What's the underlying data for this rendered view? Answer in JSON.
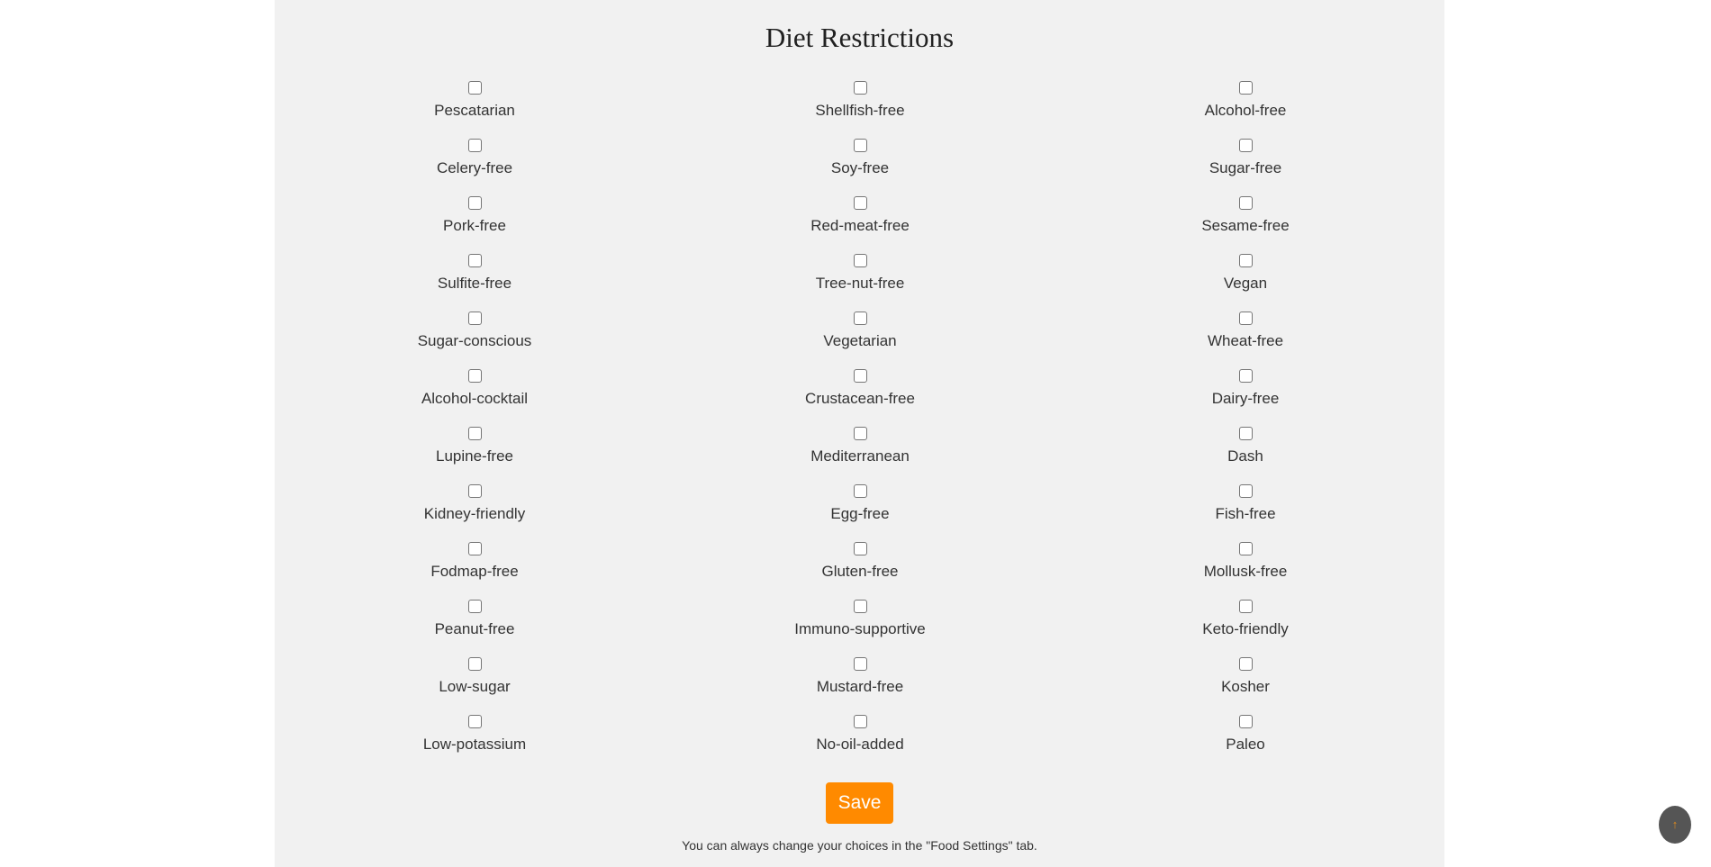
{
  "page": {
    "title": "Diet Restrictions",
    "save_label": "Save",
    "note": "You can always change your choices in the \"Food Settings\" tab.",
    "scroll_top_icon": "↑"
  },
  "colors": {
    "panel_bg": "#f1f1f1",
    "accent": "#ff8a00",
    "scroll_button": "#555555"
  },
  "columns": [
    [
      {
        "label": "Pescatarian",
        "checked": false
      },
      {
        "label": "Celery-free",
        "checked": false
      },
      {
        "label": "Pork-free",
        "checked": false
      },
      {
        "label": "Sulfite-free",
        "checked": false
      },
      {
        "label": "Sugar-conscious",
        "checked": false
      },
      {
        "label": "Alcohol-cocktail",
        "checked": false
      },
      {
        "label": "Lupine-free",
        "checked": false
      },
      {
        "label": "Kidney-friendly",
        "checked": false
      },
      {
        "label": "Fodmap-free",
        "checked": false
      },
      {
        "label": "Peanut-free",
        "checked": false
      },
      {
        "label": "Low-sugar",
        "checked": false
      },
      {
        "label": "Low-potassium",
        "checked": false
      }
    ],
    [
      {
        "label": "Shellfish-free",
        "checked": false
      },
      {
        "label": "Soy-free",
        "checked": false
      },
      {
        "label": "Red-meat-free",
        "checked": false
      },
      {
        "label": "Tree-nut-free",
        "checked": false
      },
      {
        "label": "Vegetarian",
        "checked": false
      },
      {
        "label": "Crustacean-free",
        "checked": false
      },
      {
        "label": "Mediterranean",
        "checked": false
      },
      {
        "label": "Egg-free",
        "checked": false
      },
      {
        "label": "Gluten-free",
        "checked": false
      },
      {
        "label": "Immuno-supportive",
        "checked": false
      },
      {
        "label": "Mustard-free",
        "checked": false
      },
      {
        "label": "No-oil-added",
        "checked": false
      }
    ],
    [
      {
        "label": "Alcohol-free",
        "checked": false
      },
      {
        "label": "Sugar-free",
        "checked": false
      },
      {
        "label": "Sesame-free",
        "checked": false
      },
      {
        "label": "Vegan",
        "checked": false
      },
      {
        "label": "Wheat-free",
        "checked": false
      },
      {
        "label": "Dairy-free",
        "checked": false
      },
      {
        "label": "Dash",
        "checked": false
      },
      {
        "label": "Fish-free",
        "checked": false
      },
      {
        "label": "Mollusk-free",
        "checked": false
      },
      {
        "label": "Keto-friendly",
        "checked": false
      },
      {
        "label": "Kosher",
        "checked": false
      },
      {
        "label": "Paleo",
        "checked": false
      }
    ]
  ]
}
